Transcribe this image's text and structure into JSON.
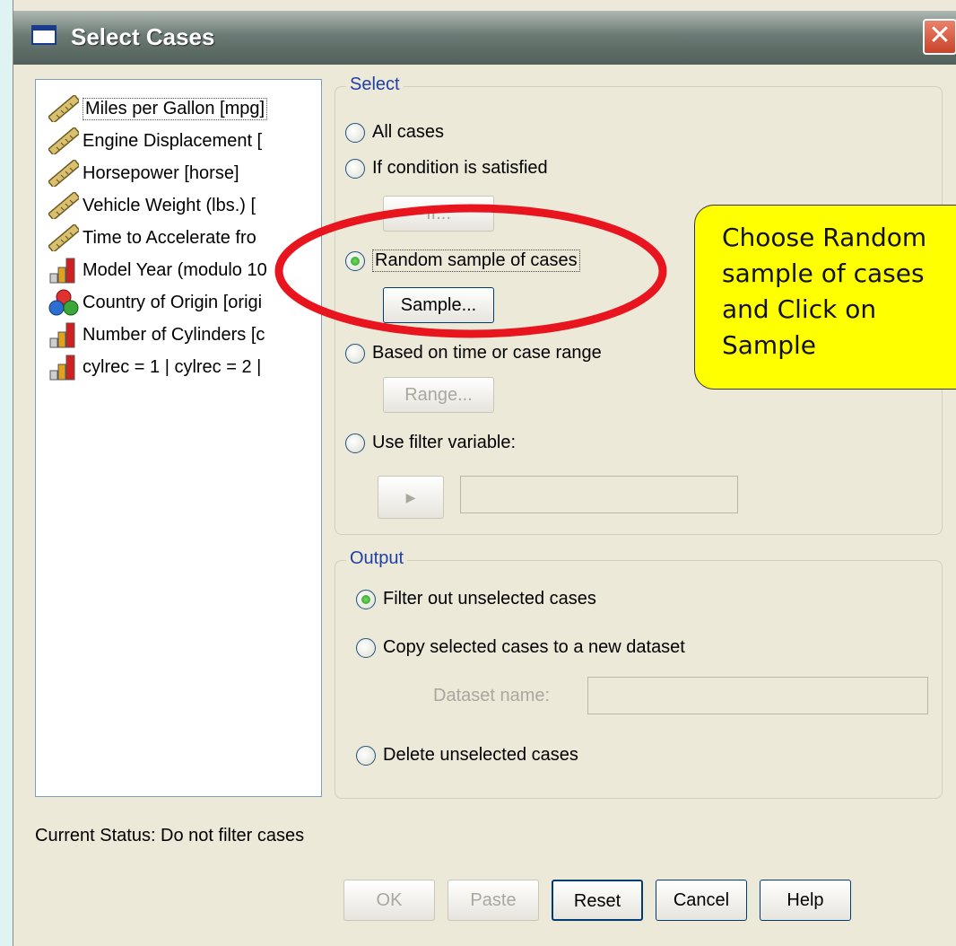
{
  "window": {
    "title": "Select Cases",
    "close_label": "✕"
  },
  "variables": [
    {
      "label": "Miles per Gallon [mpg]",
      "icon": "ruler-icon"
    },
    {
      "label": "Engine Displacement [",
      "icon": "ruler-icon"
    },
    {
      "label": "Horsepower [horse]",
      "icon": "ruler-icon"
    },
    {
      "label": "Vehicle Weight (lbs.) [",
      "icon": "ruler-icon"
    },
    {
      "label": "Time to Accelerate fro",
      "icon": "ruler-icon"
    },
    {
      "label": "Model Year (modulo 10",
      "icon": "bar-chart-icon"
    },
    {
      "label": "Country of Origin [origi",
      "icon": "nominal-circles-icon"
    },
    {
      "label": "Number of Cylinders [c",
      "icon": "bar-chart-icon"
    },
    {
      "label": "cylrec = 1 | cylrec = 2 |",
      "icon": "bar-chart-icon"
    }
  ],
  "select_group": {
    "label": "Select",
    "options": [
      {
        "label": "All cases",
        "checked": false
      },
      {
        "label": "If condition is satisfied",
        "checked": false
      },
      {
        "label": "Random sample of cases",
        "checked": true
      },
      {
        "label": "Based on time or case range",
        "checked": false
      },
      {
        "label": "Use filter variable:",
        "checked": false
      }
    ],
    "if_button": "If...",
    "sample_button": "Sample...",
    "range_button": "Range...",
    "arrow_button": "▶",
    "filter_variable_value": ""
  },
  "output_group": {
    "label": "Output",
    "options": [
      {
        "label": "Filter out unselected cases",
        "checked": true
      },
      {
        "label": "Copy selected cases to a new dataset",
        "checked": false
      },
      {
        "label": "Delete unselected cases",
        "checked": false
      }
    ],
    "dataset_label": "Dataset name:",
    "dataset_value": ""
  },
  "status": "Current Status: Do not filter cases",
  "buttons": {
    "ok": "OK",
    "paste": "Paste",
    "reset": "Reset",
    "cancel": "Cancel",
    "help": "Help"
  },
  "callout": {
    "line1": "Choose Random",
    "line2": "sample of cases",
    "line3": "and Click on",
    "line4": "Sample"
  },
  "colors": {
    "highlight_ellipse": "#e8141e",
    "callout_bg": "#ffff00",
    "radio_checked": "#2c9a22"
  }
}
